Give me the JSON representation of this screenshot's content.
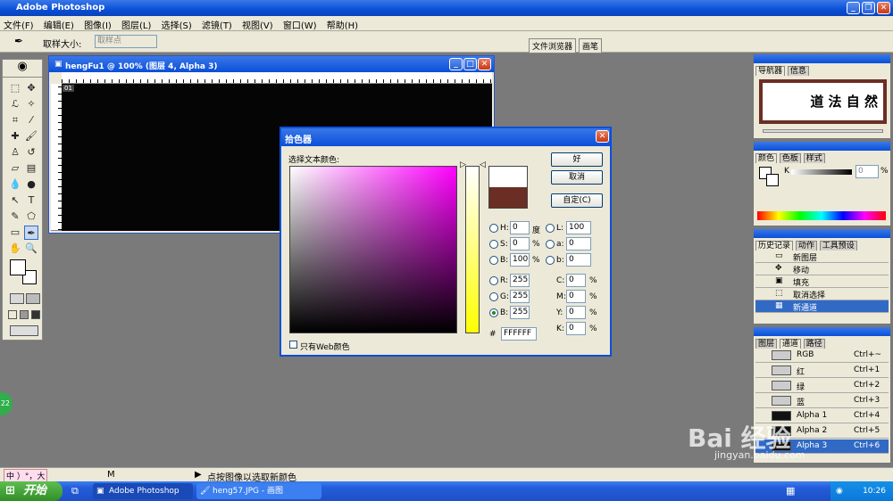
{
  "app": {
    "title": "Adobe Photoshop"
  },
  "menu": [
    "文件(F)",
    "编辑(E)",
    "图像(I)",
    "图层(L)",
    "选择(S)",
    "滤镜(T)",
    "视图(V)",
    "窗口(W)",
    "帮助(H)"
  ],
  "options": {
    "sample_size_label": "取样大小:",
    "sample_size_value": "取样点",
    "tab_file_browser": "文件浏览器",
    "tab_brushes": "画笔"
  },
  "document": {
    "title": "hengFu1 @ 100% (图层 4, Alpha 3)",
    "badge": "01"
  },
  "picker": {
    "title": "拾色器",
    "prompt": "选择文本颜色:",
    "ok": "好",
    "cancel": "取消",
    "custom": "自定(C)",
    "web_only": "只有Web颜色",
    "hsb": [
      {
        "label": "H:",
        "value": "0",
        "unit": "度"
      },
      {
        "label": "S:",
        "value": "0",
        "unit": "%"
      },
      {
        "label": "B:",
        "value": "100",
        "unit": "%"
      }
    ],
    "lab": [
      {
        "label": "L:",
        "value": "100"
      },
      {
        "label": "a:",
        "value": "0"
      },
      {
        "label": "b:",
        "value": "0"
      }
    ],
    "rgb": [
      {
        "label": "R:",
        "value": "255"
      },
      {
        "label": "G:",
        "value": "255"
      },
      {
        "label": "B:",
        "value": "255"
      }
    ],
    "cmyk": [
      {
        "label": "C:",
        "value": "0",
        "unit": "%"
      },
      {
        "label": "M:",
        "value": "0",
        "unit": "%"
      },
      {
        "label": "Y:",
        "value": "0",
        "unit": "%"
      },
      {
        "label": "K:",
        "value": "0",
        "unit": "%"
      }
    ],
    "hex_label": "#",
    "hex": "FFFFFF",
    "new_color": "#ffffff",
    "old_color": "#6b2e24"
  },
  "navigator": {
    "tabs": [
      "导航器",
      "信息"
    ],
    "preview_text": "道 法 自 然"
  },
  "color_panel": {
    "tabs": [
      "颜色",
      "色板",
      "样式"
    ],
    "k_label": "K",
    "k_value": "0",
    "k_unit": "%"
  },
  "history": {
    "tabs": [
      "历史记录",
      "动作",
      "工具预设"
    ],
    "items": [
      "新图层",
      "移动",
      "填充",
      "取消选择",
      "新通道"
    ]
  },
  "channels": {
    "tabs": [
      "图层",
      "通道",
      "路径"
    ],
    "items": [
      {
        "name": "RGB",
        "key": "Ctrl+~"
      },
      {
        "name": "红",
        "key": "Ctrl+1"
      },
      {
        "name": "绿",
        "key": "Ctrl+2"
      },
      {
        "name": "蓝",
        "key": "Ctrl+3"
      },
      {
        "name": "Alpha 1",
        "key": "Ctrl+4"
      },
      {
        "name": "Alpha 2",
        "key": "Ctrl+5"
      },
      {
        "name": "Alpha 3",
        "key": "Ctrl+6"
      }
    ]
  },
  "status": {
    "ime": "中 ）°，大",
    "hint": "点按图像以选取新颜色",
    "zoom_fragment": "M"
  },
  "taskbar": {
    "start": "开始",
    "tasks": [
      "Adobe Photoshop",
      "heng57.JPG - 画图"
    ],
    "time": "10:26"
  },
  "watermark": {
    "brand": "Bai 经验",
    "url": "jingyan.baidu.com"
  },
  "badge_number": "22"
}
